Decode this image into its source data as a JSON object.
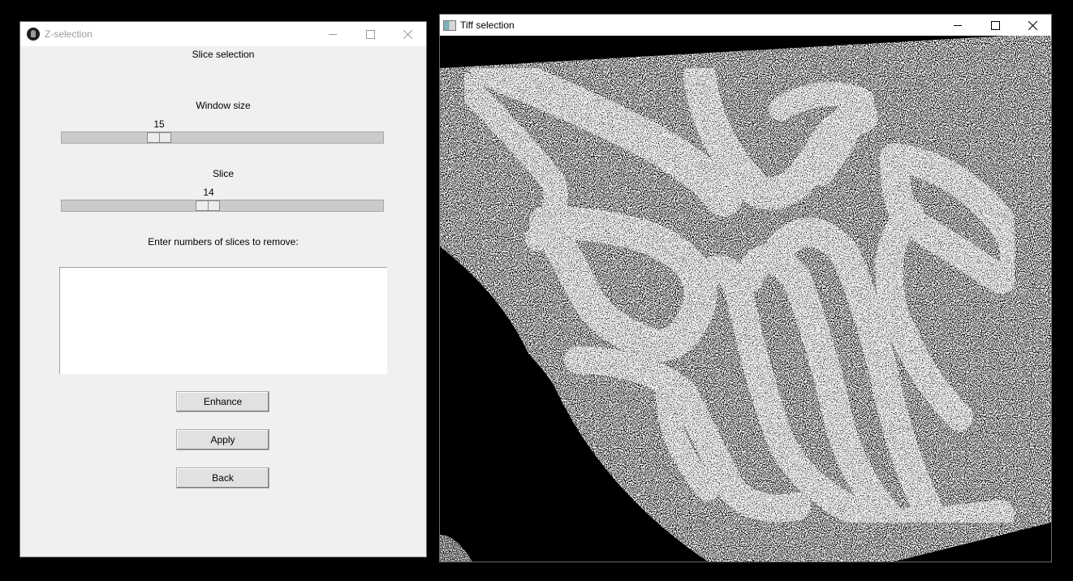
{
  "left_window": {
    "title": "Z-selection",
    "heading": "Slice selection",
    "window_size": {
      "label": "Window size",
      "value": "15"
    },
    "slice": {
      "label": "Slice",
      "value": "14"
    },
    "remove_label": "Enter numbers of slices to remove:",
    "remove_input": "",
    "buttons": {
      "enhance": "Enhance",
      "apply": "Apply",
      "back": "Back"
    }
  },
  "right_window": {
    "title": "Tiff selection",
    "image_icon": "tiff-image-icon"
  },
  "icons": [
    "app-icon",
    "minimize-icon",
    "maximize-icon",
    "close-icon",
    "tiff-image-icon"
  ],
  "colors": {
    "window_bg": "#f0f0f0",
    "slider_track": "#cbcbcb",
    "desktop": "#000000"
  }
}
